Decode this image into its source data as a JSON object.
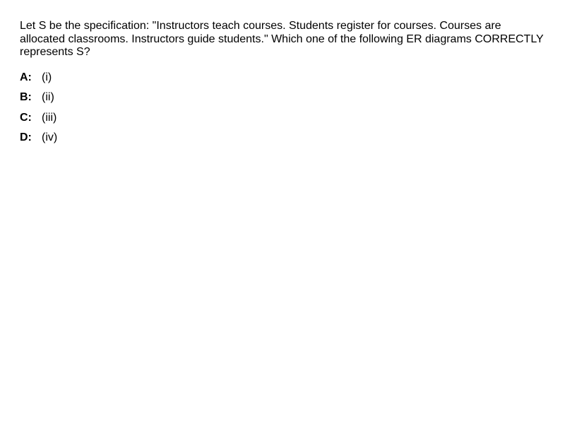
{
  "question": {
    "text": "Let S be the specification: \"Instructors teach courses. Students register for courses. Courses are allocated classrooms. Instructors guide students.\" Which one of the following ER diagrams CORRECTLY represents S?"
  },
  "options": [
    {
      "letter": "A:",
      "text": "(i)"
    },
    {
      "letter": "B:",
      "text": "(ii)"
    },
    {
      "letter": "C:",
      "text": "(iii)"
    },
    {
      "letter": "D:",
      "text": "(iv)"
    }
  ]
}
